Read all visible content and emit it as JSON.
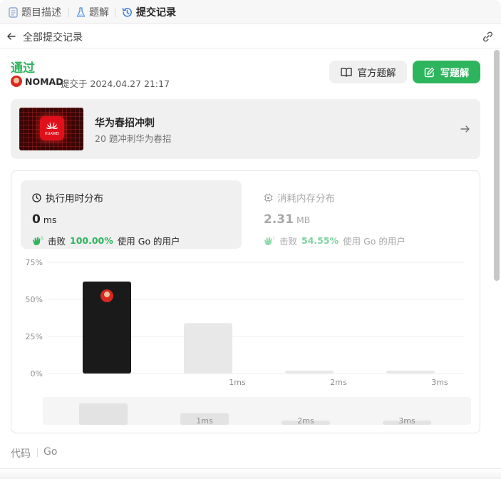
{
  "tabs": [
    {
      "label": "题目描述",
      "icon": "document-icon",
      "active": false
    },
    {
      "label": "题解",
      "icon": "flask-icon",
      "active": false
    },
    {
      "label": "提交记录",
      "icon": "history-icon",
      "active": true
    }
  ],
  "subheader": {
    "title": "全部提交记录",
    "back_icon": "arrow-left-icon",
    "share_icon": "link-icon"
  },
  "submission": {
    "status": "通过",
    "status_color": "#2db55d",
    "username": "NOMAD",
    "submitted_text": "提交于 2024.04.27 21:17"
  },
  "buttons": {
    "official": "官方题解",
    "write": "写题解"
  },
  "promo": {
    "title": "华为春招冲刺",
    "subtitle": "20 题冲刺华为春招",
    "logo_text": "HUAWEI"
  },
  "runtime": {
    "heading": "执行用时分布",
    "value": "0",
    "unit": "ms",
    "beat_label": "击败",
    "beat_pct": "100.00%",
    "beat_suffix": "使用 Go 的用户"
  },
  "memory": {
    "heading": "消耗内存分布",
    "value": "2.31",
    "unit": "MB",
    "beat_label": "击败",
    "beat_pct": "54.55%",
    "beat_suffix": "使用 Go 的用户"
  },
  "chart_data": {
    "type": "bar",
    "categories": [
      "0ms",
      "1ms",
      "2ms",
      "3ms"
    ],
    "tick_labels": [
      "",
      "1ms",
      "2ms",
      "3ms"
    ],
    "values": [
      62,
      34,
      2,
      2
    ],
    "highlight_index": 0,
    "ylim": [
      0,
      75
    ],
    "yticks": [
      "75%",
      "50%",
      "25%",
      "0%"
    ],
    "grid": true,
    "overview_values": [
      62,
      34,
      2,
      2
    ],
    "colors": {
      "highlight": "#1a1a1a",
      "bar": "#e8e8e8",
      "grid": "#eeeeee"
    }
  },
  "code": {
    "label": "代码",
    "language": "Go"
  }
}
